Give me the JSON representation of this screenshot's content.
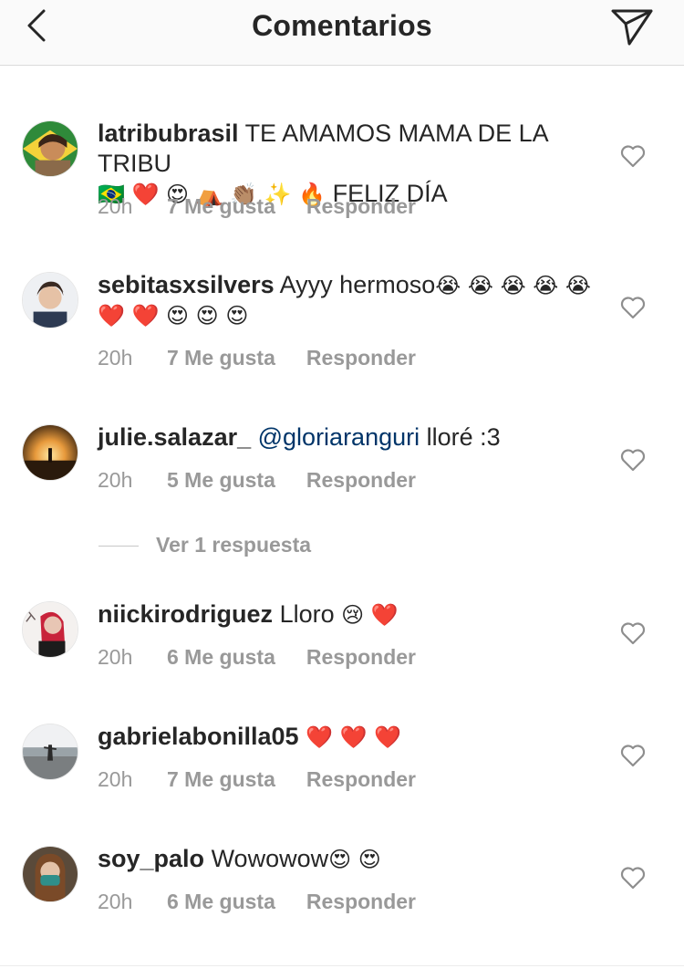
{
  "header": {
    "title": "Comentarios",
    "back_icon": "chevron-left-icon",
    "direct_icon": "paper-plane-icon"
  },
  "comments": [
    {
      "username": "latribubrasil",
      "text": "TE AMAMOS MAMA DE LA TRIBU",
      "emojis_1": "🇧🇷 ❤️ 😍 ⛺ 👏🏽 ✨ 🔥",
      "text_2": "FELIZ DÍA",
      "time": "20h",
      "likes": "7 Me gusta",
      "reply": "Responder"
    },
    {
      "username": "sebitasxsilvers",
      "text": "Ayyy hermoso",
      "emojis_1": "😭 😭 😭 😭 😭 ❤️ ❤️ 😍 😍 😍",
      "time": "20h",
      "likes": "7 Me gusta",
      "reply": "Responder"
    },
    {
      "username": "julie.salazar_",
      "mention": "@gloriaranguri",
      "text": "lloré :3",
      "time": "20h",
      "likes": "5 Me gusta",
      "reply": "Responder"
    },
    {
      "username": "niickirodriguez",
      "text": "Lloro",
      "emojis_1": "😢 ❤️",
      "time": "20h",
      "likes": "6 Me gusta",
      "reply": "Responder"
    },
    {
      "username": "gabrielabonilla05",
      "emojis_1": "❤️ ❤️ ❤️",
      "time": "20h",
      "likes": "7 Me gusta",
      "reply": "Responder"
    },
    {
      "username": "soy_palo",
      "text": "Wowowow",
      "emojis_1": "😍 😍",
      "time": "20h",
      "likes": "6 Me gusta",
      "reply": "Responder"
    }
  ],
  "view_replies": "Ver 1 respuesta",
  "colors": {
    "text": "#262626",
    "meta": "#999999",
    "mention": "#003569",
    "header_bg": "#fafafa",
    "divider": "#dbdbdb"
  },
  "icons": {
    "like": "heart-outline-icon"
  }
}
